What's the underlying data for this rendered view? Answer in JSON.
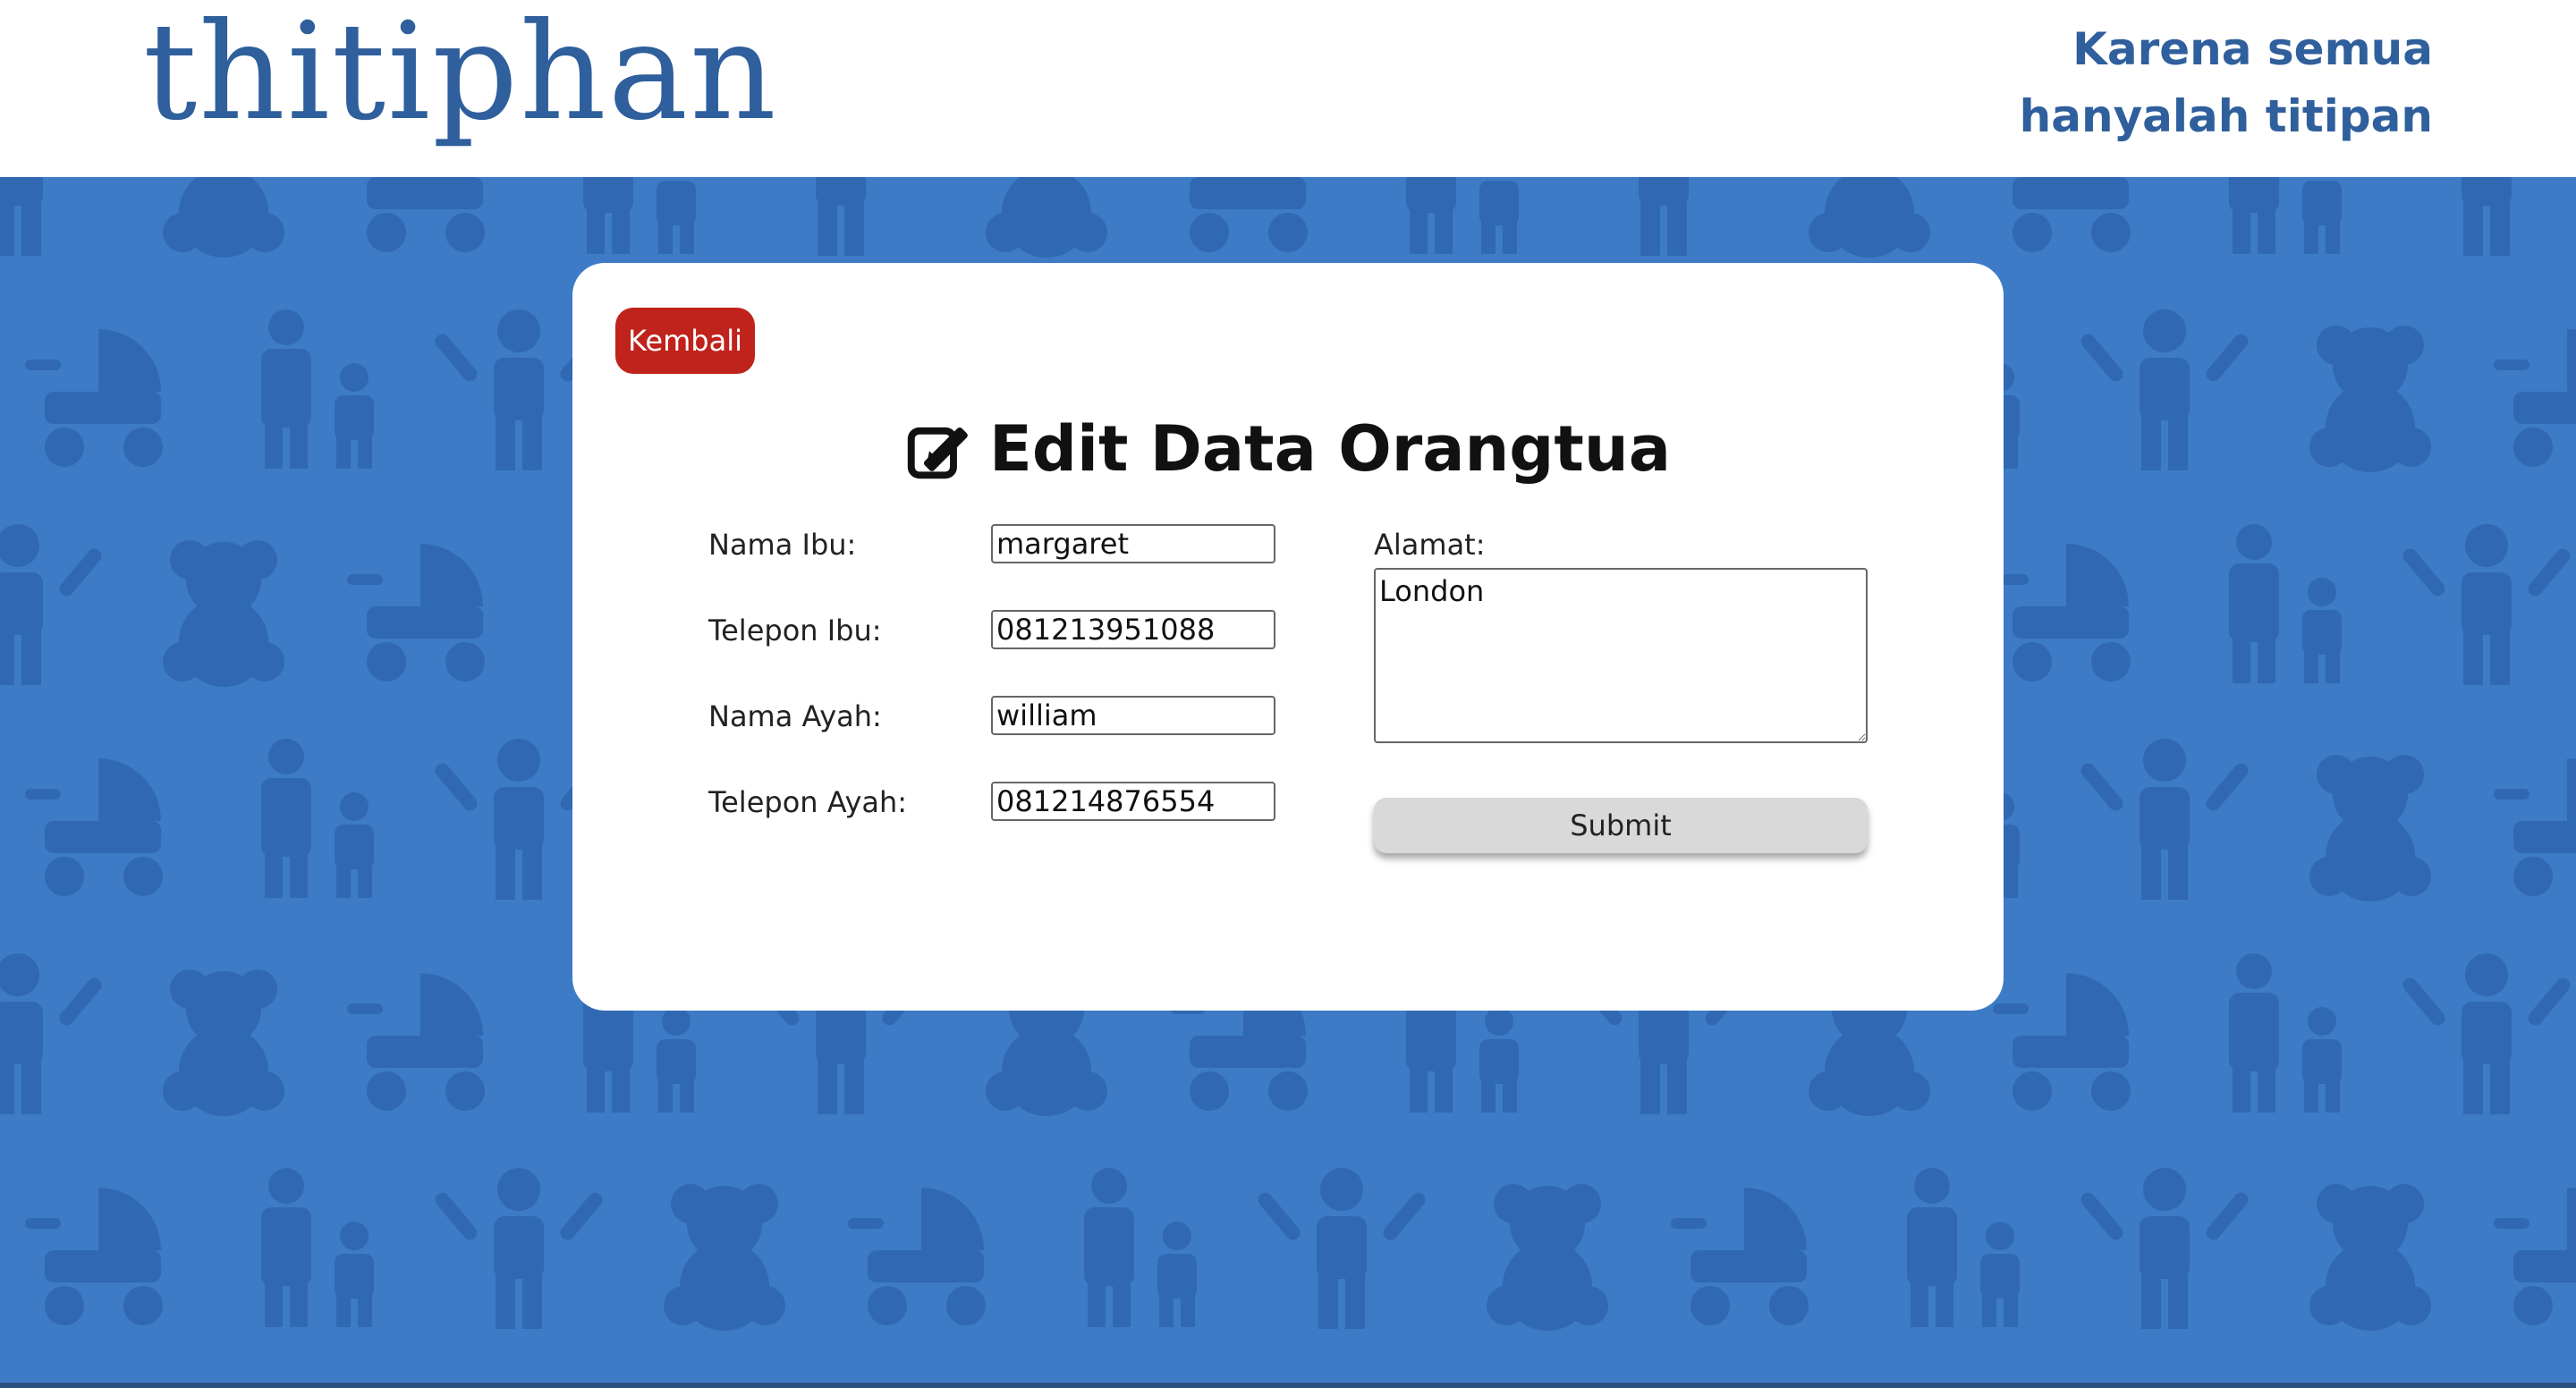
{
  "header": {
    "logo_text": "thitiphan",
    "tagline_line1": "Karena semua",
    "tagline_line2": "hanyalah titipan"
  },
  "card": {
    "back_label": "Kembali",
    "title": "Edit Data Orangtua",
    "title_icon": "edit-icon"
  },
  "form": {
    "nama_ibu_label": "Nama Ibu:",
    "nama_ibu_value": "margaret",
    "telepon_ibu_label": "Telepon Ibu:",
    "telepon_ibu_value": "081213951088",
    "nama_ayah_label": "Nama Ayah:",
    "nama_ayah_value": "william",
    "telepon_ayah_label": "Telepon Ayah:",
    "telepon_ayah_value": "081214876554",
    "alamat_label": "Alamat:",
    "alamat_value": "London",
    "submit_label": "Submit"
  },
  "colors": {
    "brand": "#2f5f9c",
    "background": "#3d7bc6",
    "pattern": "#3068b2",
    "back_button": "#c0231c"
  }
}
